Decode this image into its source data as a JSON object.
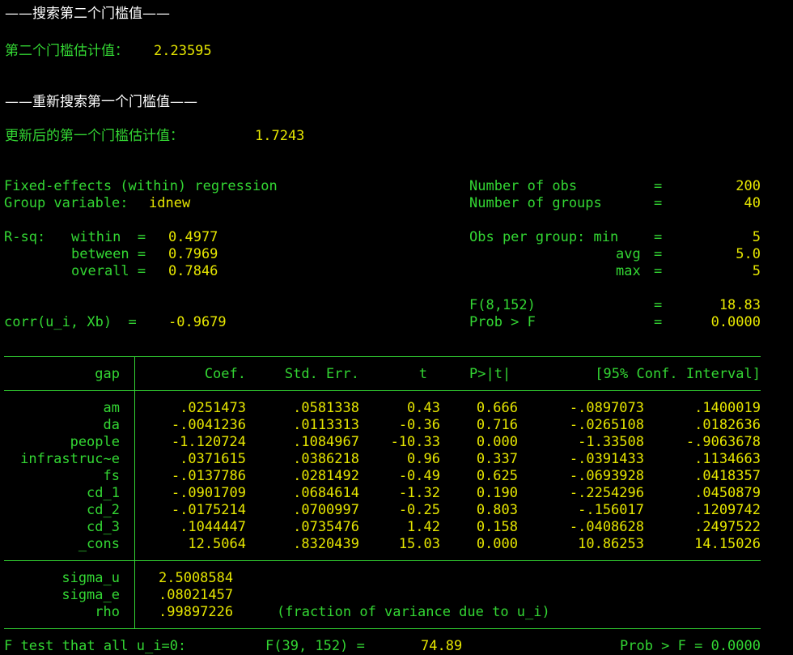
{
  "headings": {
    "search_second": "——搜索第二个门槛值——",
    "second_estimate_label": "第二个门槛估计值：",
    "second_estimate_value": "2.23595",
    "research_first": "——重新搜索第一个门槛值——",
    "first_estimate_label": "更新后的第一个门槛估计值：",
    "first_estimate_value": "1.7243"
  },
  "header": {
    "title": "Fixed-effects (within) regression",
    "group_var_label": "Group variable: ",
    "group_var_value": "idnew",
    "rsq_label": "R-sq:",
    "within_label": "within  = ",
    "within_value": "0.4977",
    "between_label": "between = ",
    "between_value": "0.7969",
    "overall_label": "overall = ",
    "overall_value": "0.7846",
    "corr_label": "corr(u_i, Xb)  = ",
    "corr_value": "-0.9679",
    "nobs_label": "Number of obs",
    "nobs_value": "200",
    "ngroups_label": "Number of groups",
    "ngroups_value": "40",
    "obs_per_group_label": "Obs per group: min",
    "min_value": "5",
    "avg_label": "avg",
    "avg_value": "5.0",
    "max_label": "max",
    "max_value": "5",
    "f_label": "F(8,152)",
    "f_value": "18.83",
    "probf_label": "Prob > F",
    "probf_value": "0.0000",
    "eq": "="
  },
  "table": {
    "depvar": "gap",
    "columns": [
      "Coef.",
      "Std. Err.",
      "t",
      "P>|t|",
      "[95% Conf. Interval]"
    ],
    "rows": [
      {
        "name": "am",
        "coef": ".0251473",
        "se": ".0581338",
        "t": "0.43",
        "p": "0.666",
        "lo": "-.0897073",
        "hi": ".1400019"
      },
      {
        "name": "da",
        "coef": "-.0041236",
        "se": ".0113313",
        "t": "-0.36",
        "p": "0.716",
        "lo": "-.0265108",
        "hi": ".0182636"
      },
      {
        "name": "people",
        "coef": "-1.120724",
        "se": ".1084967",
        "t": "-10.33",
        "p": "0.000",
        "lo": "-1.33508",
        "hi": "-.9063678"
      },
      {
        "name": "infrastruc~e",
        "coef": ".0371615",
        "se": ".0386218",
        "t": "0.96",
        "p": "0.337",
        "lo": "-.0391433",
        "hi": ".1134663"
      },
      {
        "name": "fs",
        "coef": "-.0137786",
        "se": ".0281492",
        "t": "-0.49",
        "p": "0.625",
        "lo": "-.0693928",
        "hi": ".0418357"
      },
      {
        "name": "cd_1",
        "coef": "-.0901709",
        "se": ".0684614",
        "t": "-1.32",
        "p": "0.190",
        "lo": "-.2254296",
        "hi": ".0450879"
      },
      {
        "name": "cd_2",
        "coef": "-.0175214",
        "se": ".0700997",
        "t": "-0.25",
        "p": "0.803",
        "lo": "-.156017",
        "hi": ".1209742"
      },
      {
        "name": "cd_3",
        "coef": ".1044447",
        "se": ".0735476",
        "t": "1.42",
        "p": "0.158",
        "lo": "-.0408628",
        "hi": ".2497522"
      },
      {
        "name": "_cons",
        "coef": "12.5064",
        "se": ".8320439",
        "t": "15.03",
        "p": "0.000",
        "lo": "10.86253",
        "hi": "14.15026"
      }
    ],
    "sigma": [
      {
        "name": "sigma_u",
        "value": "2.5008584"
      },
      {
        "name": "sigma_e",
        "value": ".08021457"
      },
      {
        "name": "rho",
        "value": ".99897226",
        "note": "(fraction of variance due to u_i)"
      }
    ],
    "ftest": {
      "label": "F test that all u_i=0:",
      "f_label": "F(39, 152) =",
      "f_value": "74.89",
      "prob": "Prob > F = 0.0000"
    }
  }
}
